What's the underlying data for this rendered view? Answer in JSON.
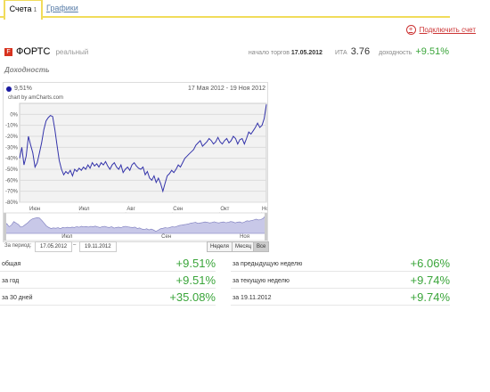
{
  "tabs": [
    {
      "label": "Счета",
      "count": "1"
    },
    {
      "label": "Графики"
    }
  ],
  "connect_label": "Подключить счет",
  "account": {
    "name": "ФОРТС",
    "type": "реальный"
  },
  "stats": {
    "start_label": "начало торгов",
    "start_date": "17.05.2012",
    "ita_label": "ИТА",
    "ita_value": "3.76",
    "profit_label": "доходность",
    "profit_value": "+9.51%"
  },
  "section_title": "Доходность",
  "chart_data": {
    "type": "line",
    "legend": "9,51%",
    "range_text": "17 Мая 2012 - 19 Ноя 2012",
    "credit": "chart by amCharts.com",
    "y_ticks": [
      "0%",
      "-10%",
      "-20%",
      "-30%",
      "-40%",
      "-50%",
      "-60%",
      "-70%",
      "-80%"
    ],
    "ylim": [
      -80,
      10
    ],
    "month_labels": [
      "Июн",
      "Июл",
      "Авг",
      "Сен",
      "Окт",
      "Ноя"
    ],
    "scroll_labels": [
      "Июл",
      "Сен",
      "Ноя"
    ],
    "series_color": "#3333aa",
    "values": [
      -40,
      -30,
      -46,
      -38,
      -20,
      -28,
      -35,
      -48,
      -44,
      -35,
      -26,
      -14,
      -6,
      -3,
      -1,
      -2,
      -14,
      -28,
      -42,
      -50,
      -55,
      -52,
      -54,
      -51,
      -56,
      -50,
      -52,
      -49,
      -51,
      -48,
      -50,
      -46,
      -49,
      -44,
      -47,
      -45,
      -48,
      -44,
      -46,
      -43,
      -47,
      -50,
      -46,
      -44,
      -48,
      -50,
      -46,
      -53,
      -50,
      -48,
      -51,
      -46,
      -44,
      -47,
      -49,
      -50,
      -48,
      -55,
      -52,
      -58,
      -60,
      -56,
      -62,
      -58,
      -63,
      -70,
      -63,
      -56,
      -54,
      -51,
      -53,
      -50,
      -46,
      -48,
      -44,
      -40,
      -38,
      -36,
      -34,
      -32,
      -28,
      -26,
      -24,
      -29,
      -27,
      -25,
      -22,
      -24,
      -27,
      -25,
      -21,
      -25,
      -27,
      -24,
      -22,
      -26,
      -24,
      -20,
      -22,
      -27,
      -23,
      -22,
      -27,
      -22,
      -16,
      -18,
      -15,
      -12,
      -8,
      -12,
      -10,
      -4,
      9
    ]
  },
  "period": {
    "label": "За период:",
    "from": "17.05.2012",
    "to": "19.11.2012",
    "buttons": [
      "Неделя",
      "Месяц",
      "Все"
    ],
    "active": "Все"
  },
  "metrics_left": [
    {
      "label": "общая",
      "value": "+9.51%"
    },
    {
      "label": "за год",
      "value": "+9.51%"
    },
    {
      "label": "за 30 дней",
      "value": "+35.08%"
    }
  ],
  "metrics_right": [
    {
      "label": "за предыдущую неделю",
      "value": "+6.06%"
    },
    {
      "label": "за текущую неделю",
      "value": "+9.74%"
    },
    {
      "label": "за 19.11.2012",
      "value": "+9.74%"
    }
  ]
}
